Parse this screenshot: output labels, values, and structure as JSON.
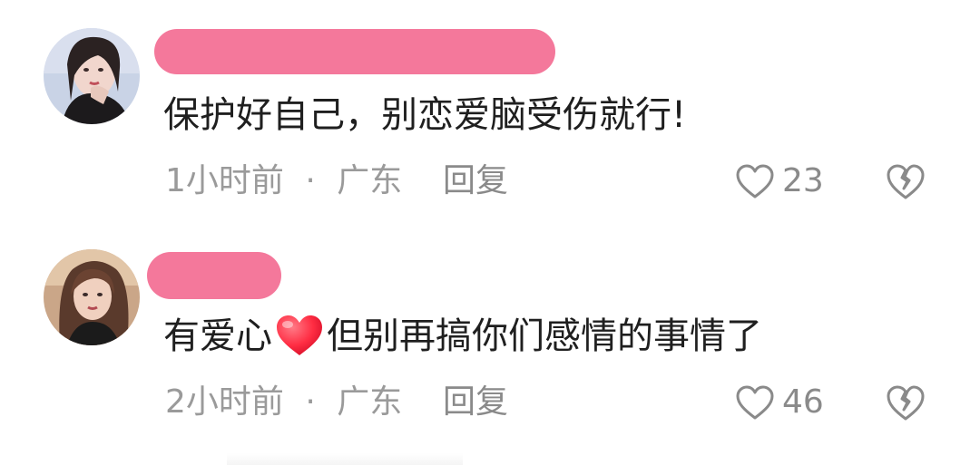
{
  "comments": [
    {
      "text": "保护好自己，别恋爱脑受伤就行!",
      "time": "1小时前",
      "separator": "·",
      "location": "广东",
      "reply_label": "回复",
      "likes": "23",
      "heart_emoji": false
    },
    {
      "text_before": "有爱心",
      "text_after": "但别再搞你们感情的事情了",
      "time": "2小时前",
      "separator": "·",
      "location": "广东",
      "reply_label": "回复",
      "likes": "46",
      "heart_emoji": true
    }
  ],
  "colors": {
    "redaction": "#f4789b",
    "text": "#1f1f1f",
    "meta": "#9a9a9a",
    "heart_emoji": "#ff2d43"
  },
  "icons": {
    "like": "heart-outline-icon",
    "dislike": "broken-heart-icon",
    "emoji": "red-heart-emoji-icon"
  }
}
